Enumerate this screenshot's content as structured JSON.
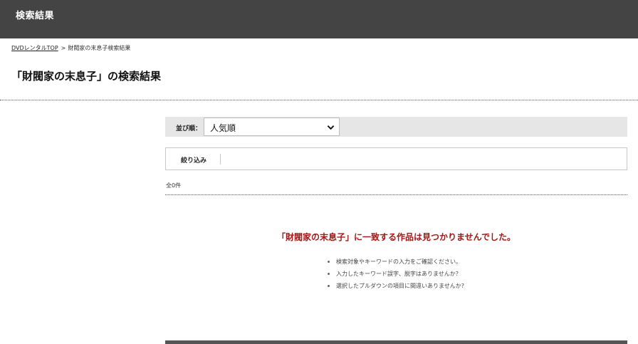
{
  "header": {
    "title": "検索結果"
  },
  "breadcrumb": {
    "home_label": "DVDレンタルTOP",
    "separator": ">",
    "current": "財閥家の末息子検索結果"
  },
  "page_title": "「財閥家の末息子」の検索結果",
  "sort": {
    "label": "並び順：",
    "selected": "人気順"
  },
  "filter": {
    "label": "絞り込み"
  },
  "result_count": "全0件",
  "no_result_message": "「財閥家の末息子」に一致する作品は見つかりませんでした。",
  "hints": [
    "検索対象やキーワードの入力をご確認ください。",
    "入力したキーワード誤字、脱字はありませんか？",
    "選択したプルダウンの項目に間違いありませんか?"
  ],
  "colors": {
    "header_bg": "#444444",
    "alert_text": "#a01818",
    "sort_bar_bg": "#e6e6e6"
  }
}
